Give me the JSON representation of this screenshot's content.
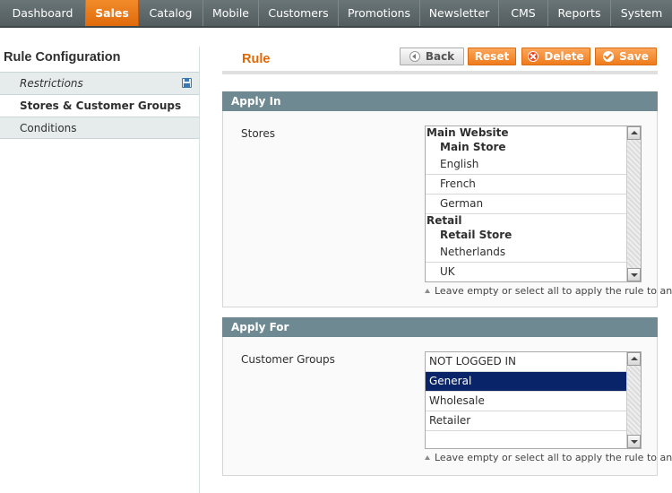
{
  "nav": {
    "items": [
      {
        "label": "Dashboard"
      },
      {
        "label": "Sales"
      },
      {
        "label": "Catalog"
      },
      {
        "label": "Mobile"
      },
      {
        "label": "Customers"
      },
      {
        "label": "Promotions"
      },
      {
        "label": "Newsletter"
      },
      {
        "label": "CMS"
      },
      {
        "label": "Reports"
      },
      {
        "label": "System"
      }
    ],
    "active": "Sales",
    "active_color": "#eb7a1c"
  },
  "sidebar": {
    "title": "Rule Configuration",
    "tabs": [
      {
        "label": "Restrictions",
        "icon": "floppy-disk-icon"
      },
      {
        "label": "Stores & Customer Groups"
      },
      {
        "label": "Conditions"
      }
    ]
  },
  "header": {
    "title": "Rule",
    "buttons": {
      "back": "Back",
      "reset": "Reset",
      "delete": "Delete",
      "save": "Save"
    }
  },
  "apply_in": {
    "heading": "Apply In",
    "stores_label": "Stores",
    "stores": {
      "website": "Main Website",
      "main_store": "Main Store",
      "english": "English",
      "french": "French",
      "german": "German",
      "retail": "Retail",
      "retail_store": "Retail Store",
      "netherlands": "Netherlands",
      "uk": "UK"
    },
    "note": "Leave empty or select all to apply the rule to any"
  },
  "apply_for": {
    "heading": "Apply For",
    "groups_label": "Customer Groups",
    "groups": [
      "NOT LOGGED IN",
      "General",
      "Wholesale",
      "Retailer"
    ],
    "selected": "General",
    "note": "Leave empty or select all to apply the rule to any"
  }
}
